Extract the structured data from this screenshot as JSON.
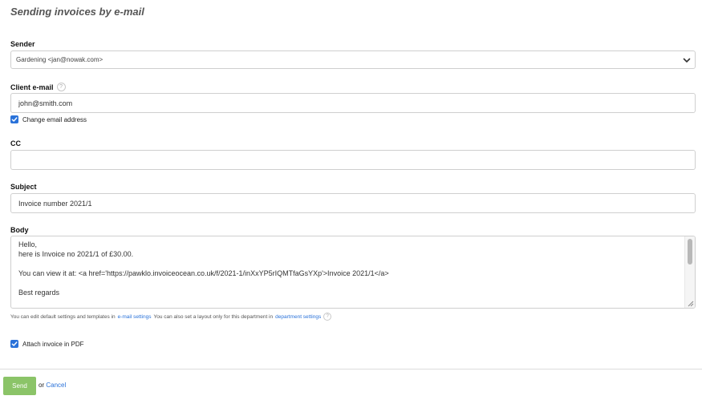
{
  "page_title": "Sending invoices by e-mail",
  "sender": {
    "label": "Sender",
    "selected": "Gardening <jan@nowak.com>"
  },
  "client_email": {
    "label": "Client e-mail",
    "value": "john@smith.com",
    "change_checkbox_label": "Change email address",
    "change_checked": true
  },
  "cc": {
    "label": "CC",
    "value": ""
  },
  "subject": {
    "label": "Subject",
    "value": "Invoice number 2021/1"
  },
  "body": {
    "label": "Body",
    "lines": [
      "Hello,",
      "here is Invoice no 2021/1 of £30.00.",
      "",
      "You can view it at: <a href='https://pawklo.invoiceocean.co.uk/f/2021-1/inXxYP5rIQMTfaGsYXp'>Invoice 2021/1</a>",
      "",
      "Best regards"
    ]
  },
  "hint": {
    "text1": "You can edit default settings and templates in",
    "link1": "e-mail settings",
    "text2": "You can also set a layout only for this department in",
    "link2": "department settings"
  },
  "attach_pdf": {
    "label": "Attach invoice in PDF",
    "checked": true
  },
  "actions": {
    "send_label": "Send",
    "or_text": "or",
    "cancel_label": "Cancel"
  },
  "colors": {
    "accent": "#2a72d9",
    "send_button": "#8bc468"
  }
}
